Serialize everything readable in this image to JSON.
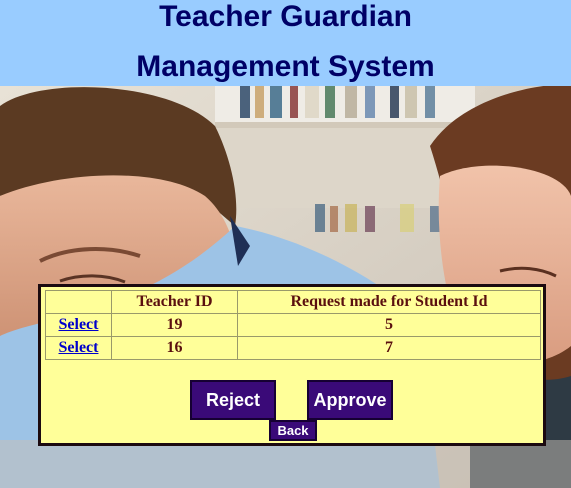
{
  "header": {
    "line1": "Teacher Guardian",
    "line2": "Management System"
  },
  "table": {
    "columns": [
      "",
      "Teacher ID",
      "Request made for Student Id"
    ],
    "rows": [
      {
        "select": "Select",
        "teacher_id": "19",
        "student_id": "5"
      },
      {
        "select": "Select",
        "teacher_id": "16",
        "student_id": "7"
      }
    ]
  },
  "actions": {
    "reject": "Reject",
    "approve": "Approve",
    "back": "Back"
  },
  "colors": {
    "header_bg": "#99ccff",
    "title": "#000066",
    "panel_bg": "#ffff99",
    "button_bg": "#3a0a78"
  }
}
